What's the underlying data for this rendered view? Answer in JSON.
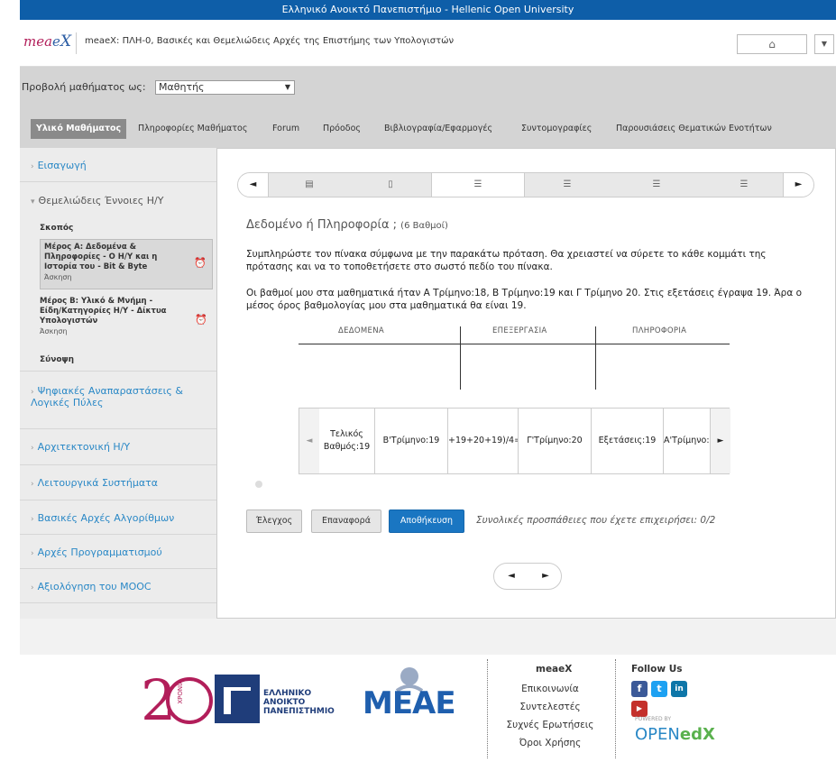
{
  "topbar": {
    "title": "Ελληνικό Ανοικτό Πανεπιστήμιο - Hellenic Open University"
  },
  "header": {
    "logo": {
      "m": "mea",
      "e": "e",
      "x": "X"
    },
    "course_title": "meaeX: ΠΛΗ-0, Βασικές και Θεμελιώδεις Αρχές της Επιστήμης των Υπολογιστών",
    "home_icon": "home-icon"
  },
  "viewbar": {
    "label": "Προβολή μαθήματος ως:",
    "selected": "Μαθητής"
  },
  "tabs": [
    {
      "label": "Υλικό Μαθήματος",
      "active": true
    },
    {
      "label": "Πληροφορίες Μαθήματος"
    },
    {
      "label": "Forum"
    },
    {
      "label": "Πρόοδος"
    },
    {
      "label": "Βιβλιογραφία/Εφαρμογές"
    },
    {
      "label": "Συντομογραφίες"
    },
    {
      "label": "Παρουσιάσεις Θεματικών Ενοτήτων"
    }
  ],
  "sidebar": {
    "sections": [
      {
        "label": "Εισαγωγή"
      },
      {
        "label": "Θεμελιώδεις Έννοιες Η/Υ"
      },
      {
        "label": "Ψηφιακές Αναπαραστάσεις & Λογικές Πύλες"
      },
      {
        "label": "Αρχιτεκτονική Η/Υ"
      },
      {
        "label": "Λειτουργικά Συστήματα"
      },
      {
        "label": "Βασικές Αρχές Αλγορίθμων"
      },
      {
        "label": "Αρχές Προγραμματισμού"
      },
      {
        "label": "Αξιολόγηση του MOOC"
      }
    ],
    "subitems": {
      "goal": "Σκοπός",
      "partA_title": "Μέρος Α: Δεδομένα & Πληροφορίες - Ο Η/Υ και η Ιστορία του - Bit & Byte",
      "partA_type": "Άσκηση",
      "partB_title": "Μέρος Β: Υλικό & Μνήμη - Είδη/Κατηγορίες Η/Υ - Δίκτυα Υπολογιστών",
      "partB_type": "Άσκηση",
      "summary": "Σύνοψη"
    }
  },
  "sequence": {
    "prev": "◄",
    "next": "►",
    "items": [
      "video-icon",
      "page-icon",
      "problem-icon",
      "problem-icon",
      "problem-icon",
      "problem-icon"
    ]
  },
  "problem": {
    "title": "Δεδομένο ή Πληροφορία ;",
    "points": "(6 Βαθμοί)",
    "instructions": "Συμπληρώστε τον πίνακα σύμφωνα με την παρακάτω πρόταση. Θα χρειαστεί να σύρετε το κάθε κομμάτι της πρότασης και να το τοποθετήσετε στο σωστό πεδίο του πίνακα.",
    "sentence": "Οι βαθμοί μου στα μαθηματικά ήταν Α Τρίμηνο:18, Β Τρίμηνο:19 και Γ Τρίμηνο 20. Στις εξετάσεις έγραψα 19. Άρα ο μέσος όρος βαθμολογίας μου στα μαθηματικά θα είναι 19.",
    "columns": [
      "ΔΕΔΟΜΕΝΑ",
      "ΕΠΕΞΕΡΓΑΣΙΑ",
      "ΠΛΗΡΟΦΟΡΙΑ"
    ],
    "chips": [
      "Τελικός Βαθμός:19",
      "Β'Τρίμηνο:19",
      "+19+20+19)/4=",
      "Γ'Τρίμηνο:20",
      "Εξετάσεις:19",
      "Α'Τρίμηνο:"
    ],
    "buttons": {
      "check": "Έλεγχος",
      "reset": "Επαναφορά",
      "save": "Αποθήκευση"
    },
    "attempts": "Συνολικές προσπάθειες που έχετε επιχειρήσει: 0/2"
  },
  "footer": {
    "logo_text": [
      "ΕΛΛΗΝΙΚΟ",
      "ΑΝΟΙΚΤΟ",
      "ΠΑΝΕΠΙΣΤΗΜΙΟ"
    ],
    "years_label": "ΧΡΟΝΙΑ",
    "meae_logo": "ΜΕΑΕ",
    "col1_title": "meaeX",
    "col1_links": [
      "Επικοινωνία",
      "Συντελεστές",
      "Συχνές Ερωτήσεις",
      "Όροι Χρήσης"
    ],
    "col2_title": "Follow Us",
    "powered_by": "POWERED BY",
    "openedx": "OPEN",
    "openedx_x": "edX"
  }
}
